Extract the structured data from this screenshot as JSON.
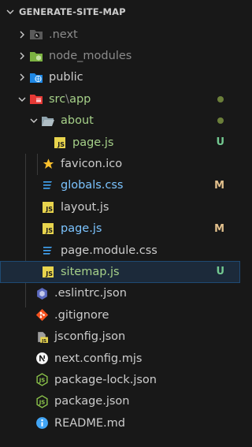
{
  "header": {
    "title": "GENERATE-SITE-MAP"
  },
  "tree": [
    {
      "name": "next-folder",
      "label": ".next",
      "style": "dim",
      "badge": "",
      "dot": false
    },
    {
      "name": "node-modules-folder",
      "label": "node_modules",
      "style": "dim",
      "badge": "",
      "dot": false
    },
    {
      "name": "public-folder",
      "label": "public",
      "style": "",
      "badge": "",
      "dot": false
    },
    {
      "name": "src-app-folder",
      "label": "src",
      "label_sep": "\\",
      "label_tail": "app",
      "style": "git-new",
      "badge": "",
      "dot": true
    },
    {
      "name": "about-folder",
      "label": "about",
      "style": "git-new",
      "badge": "",
      "dot": true
    },
    {
      "name": "about-page-js",
      "label": "page.js",
      "style": "git-new",
      "badge": "U",
      "dot": false
    },
    {
      "name": "favicon-ico",
      "label": "favicon.ico",
      "style": "",
      "badge": "",
      "dot": false
    },
    {
      "name": "globals-css",
      "label": "globals.css",
      "style": "highlight",
      "badge": "M",
      "dot": false
    },
    {
      "name": "layout-js",
      "label": "layout.js",
      "style": "",
      "badge": "",
      "dot": false
    },
    {
      "name": "page-js",
      "label": "page.js",
      "style": "highlight",
      "badge": "M",
      "dot": false
    },
    {
      "name": "page-module-css",
      "label": "page.module.css",
      "style": "",
      "badge": "",
      "dot": false
    },
    {
      "name": "sitemap-js",
      "label": "sitemap.js",
      "style": "git-new",
      "badge": "U",
      "dot": false
    },
    {
      "name": "eslintrc-json",
      "label": ".eslintrc.json",
      "style": "",
      "badge": "",
      "dot": false
    },
    {
      "name": "gitignore",
      "label": ".gitignore",
      "style": "",
      "badge": "",
      "dot": false
    },
    {
      "name": "jsconfig-json",
      "label": "jsconfig.json",
      "style": "",
      "badge": "",
      "dot": false
    },
    {
      "name": "next-config-mjs",
      "label": "next.config.mjs",
      "style": "",
      "badge": "",
      "dot": false
    },
    {
      "name": "package-lock-json",
      "label": "package-lock.json",
      "style": "",
      "badge": "",
      "dot": false
    },
    {
      "name": "package-json",
      "label": "package.json",
      "style": "",
      "badge": "",
      "dot": false
    },
    {
      "name": "readme-md",
      "label": "README.md",
      "style": "",
      "badge": "",
      "dot": false
    }
  ],
  "colors": {
    "background": "#181818",
    "selected": "#1c2a3a",
    "untracked": "#73c991",
    "modified": "#e2c08d",
    "js_icon": "#e8d44d",
    "css_icon": "#42a5f5"
  }
}
